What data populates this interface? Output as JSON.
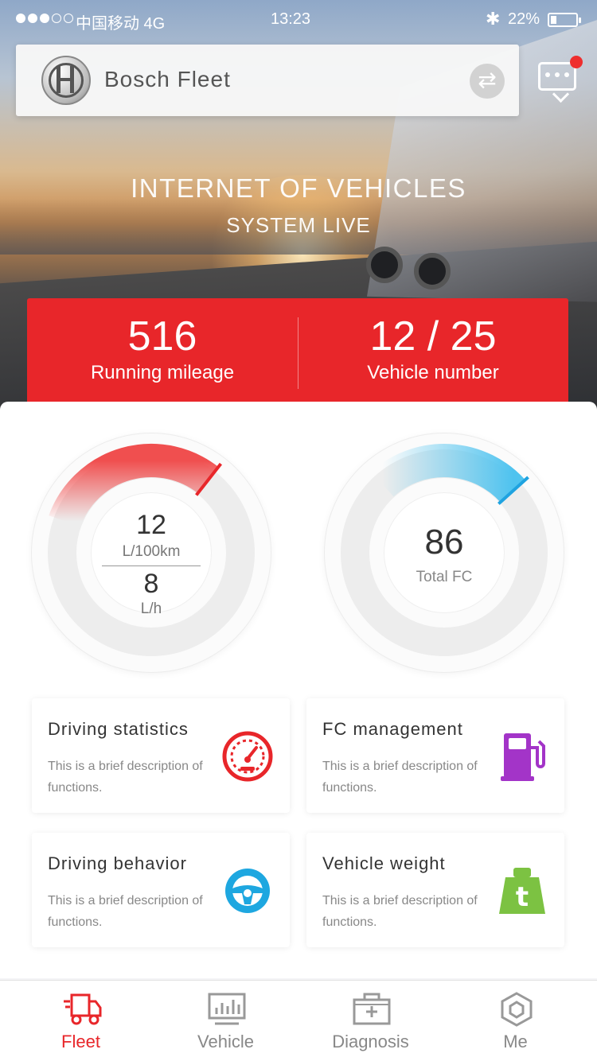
{
  "status_bar": {
    "carrier": "中国移动 4G",
    "time": "13:23",
    "battery": "22%"
  },
  "header": {
    "app_name": "Bosch Fleet",
    "switch_icon": "swap-arrows-icon",
    "message_icon": "chat-bubble-icon",
    "has_notification": true
  },
  "hero": {
    "headline": "INTERNET OF VEHICLES",
    "subline": "SYSTEM LIVE"
  },
  "stats": {
    "mileage_value": "516",
    "mileage_label": "Running mileage",
    "vehicle_value": "12 / 25",
    "vehicle_label": "Vehicle number"
  },
  "gauges": {
    "consumption": {
      "value1": "12",
      "unit1": "L/100km",
      "value2": "8",
      "unit2": "L/h",
      "fill_fraction": 0.3,
      "color": "#f05a5a"
    },
    "total": {
      "value": "86",
      "unit": "Total FC",
      "fill_fraction": 0.25,
      "color": "#4fc3ef"
    }
  },
  "tiles": [
    {
      "title": "Driving statistics",
      "desc": "This is a brief description of functions.",
      "icon": "speedometer-icon",
      "color": "#e8262a"
    },
    {
      "title": "FC management",
      "desc": "This is a brief description of functions.",
      "icon": "fuel-pump-icon",
      "color": "#a334c8"
    },
    {
      "title": "Driving behavior",
      "desc": "This is a brief description of functions.",
      "icon": "steering-wheel-icon",
      "color": "#1ea7e0"
    },
    {
      "title": "Vehicle weight",
      "desc": "This is a brief description of functions.",
      "icon": "weight-icon",
      "color": "#7cc242"
    }
  ],
  "tabs": [
    {
      "label": "Fleet",
      "icon": "truck-icon",
      "active": true
    },
    {
      "label": "Vehicle",
      "icon": "dashboard-icon",
      "active": false
    },
    {
      "label": "Diagnosis",
      "icon": "first-aid-kit-icon",
      "active": false
    },
    {
      "label": "Me",
      "icon": "hexagon-user-icon",
      "active": false
    }
  ],
  "colors": {
    "brand_red": "#e8262a",
    "tab_active": "#e8262a",
    "tab_inactive": "#888888"
  }
}
